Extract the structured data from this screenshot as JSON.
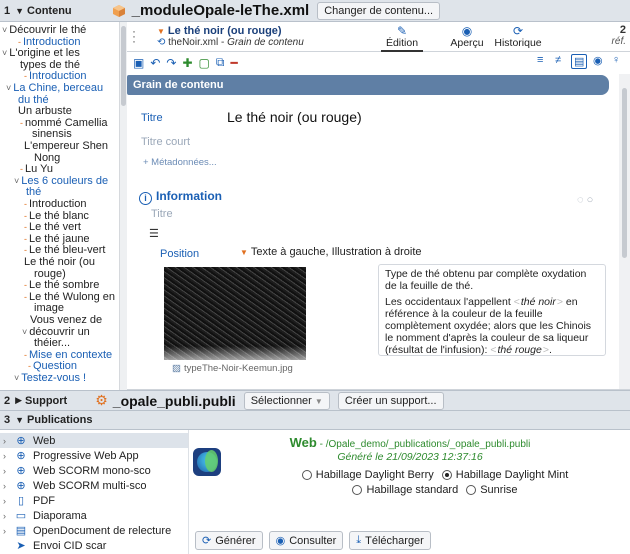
{
  "section1": {
    "number": "1",
    "label": "Contenu",
    "item_icon": "orange-cube-icon",
    "file": "_moduleOpale-leThe.xml",
    "change_button": "Changer de contenu..."
  },
  "tree": [
    {
      "text": "Découvrir le thé",
      "color": "dark",
      "marker": "v"
    },
    {
      "text": "Introduction",
      "color": "blue",
      "marker": "-"
    },
    {
      "text": "L'origine et les",
      "color": "dark",
      "marker": "v"
    },
    {
      "text": "types de thé",
      "color": "dark",
      "marker": ""
    },
    {
      "text": "Introduction",
      "color": "blue",
      "marker": "-"
    },
    {
      "text": "La Chine, berceau",
      "color": "blue",
      "marker": "v"
    },
    {
      "text": "du thé",
      "color": "blue",
      "marker": ""
    },
    {
      "text": "Un arbuste",
      "color": "dark",
      "marker": ""
    },
    {
      "text": "nommé Camellia",
      "color": "dark",
      "marker": "-"
    },
    {
      "text": "sinensis",
      "color": "dark",
      "marker": ""
    },
    {
      "text": "L'empereur Shen",
      "color": "dark",
      "marker": ""
    },
    {
      "text": "Nong",
      "color": "dark",
      "marker": ""
    },
    {
      "text": "Lu Yu",
      "color": "dark",
      "marker": "-"
    },
    {
      "text": "Les 6 couleurs de",
      "color": "blue",
      "marker": "v"
    },
    {
      "text": "thé",
      "color": "blue",
      "marker": ""
    },
    {
      "text": "Introduction",
      "color": "dark",
      "marker": "-"
    },
    {
      "text": "Le thé blanc",
      "color": "dark",
      "marker": "-"
    },
    {
      "text": "Le thé vert",
      "color": "dark",
      "marker": "-"
    },
    {
      "text": "Le thé jaune",
      "color": "dark",
      "marker": "-"
    },
    {
      "text": "Le thé bleu-vert",
      "color": "dark",
      "marker": "-"
    },
    {
      "text": "Le thé noir (ou",
      "color": "dark",
      "marker": ""
    },
    {
      "text": "rouge)",
      "color": "dark",
      "marker": ""
    },
    {
      "text": "Le thé sombre",
      "color": "dark",
      "marker": "-"
    },
    {
      "text": "Le thé Wulong en",
      "color": "dark",
      "marker": "-"
    },
    {
      "text": "image",
      "color": "dark",
      "marker": ""
    },
    {
      "text": "Vous venez de",
      "color": "dark",
      "marker": ""
    },
    {
      "text": "découvrir un",
      "color": "dark",
      "marker": "v"
    },
    {
      "text": "théier...",
      "color": "dark",
      "marker": ""
    },
    {
      "text": "Mise en contexte",
      "color": "blue",
      "marker": "-"
    },
    {
      "text": "Question",
      "color": "blue",
      "marker": "-"
    },
    {
      "text": "Testez-vous !",
      "color": "blue",
      "marker": "v"
    }
  ],
  "editor": {
    "title": "Le thé noir (ou rouge)",
    "file": "theNoir.xml",
    "type": "Grain de contenu",
    "separator": " - ",
    "tabs": [
      {
        "label": "Édition",
        "icon": "pen-icon"
      },
      {
        "label": "Aperçu",
        "icon": "eye-icon"
      },
      {
        "label": "Historique",
        "icon": "history-icon"
      }
    ],
    "ref_count": "2",
    "ref_label": "réf."
  },
  "grain": {
    "header": "Grain de contenu",
    "title_label": "Titre",
    "title_value": "Le thé noir (ou rouge)",
    "short_title_label": "Titre court",
    "metadata": "+ Métadonnées...",
    "info_label": "Information",
    "info_title_label": "Titre",
    "position_label": "Position",
    "position_value": "Texte à gauche, Illustration à droite",
    "image_name": "typeThe-Noir-Keemun.jpg",
    "text_p1": "Type de thé obtenu par complète oxydation de la feuille de thé.",
    "text_p2a": "Les occidentaux l'appellent",
    "kw1": "thé noir",
    "text_p2b": "en référence à la couleur de la feuille complètement oxydée",
    "text_p2c": "; alors que les Chinois le nomment d'après la couleur de sa liqueur (résultat de l'infusion)",
    "text_p2d": ":",
    "kw2": "thé rouge",
    "text_p2e": "."
  },
  "section2": {
    "number": "2",
    "label": "Support",
    "icon": "gear-icon",
    "file": "_opale_publi.publi",
    "select_button": "Sélectionner",
    "create_button": "Créer un support..."
  },
  "section3": {
    "number": "3",
    "label": "Publications"
  },
  "publications": [
    {
      "label": "Web",
      "icon": "globe-icon",
      "selected": true
    },
    {
      "label": "Progressive Web App",
      "icon": "globe-icon",
      "selected": false
    },
    {
      "label": "Web SCORM mono-sco",
      "icon": "globe-icon",
      "selected": false
    },
    {
      "label": "Web SCORM multi-sco",
      "icon": "globe-icon",
      "selected": false
    },
    {
      "label": "PDF",
      "icon": "pdf-icon",
      "selected": false
    },
    {
      "label": "Diaporama",
      "icon": "slideshow-icon",
      "selected": false
    },
    {
      "label": "OpenDocument de relecture",
      "icon": "document-icon",
      "selected": false
    },
    {
      "label": "Envoi CID scar",
      "icon": "send-icon",
      "selected": false
    }
  ],
  "panel": {
    "name": "Web",
    "path": " - /Opale_demo/_publications/_opale_publi.publi",
    "date": "Généré le 21/09/2023 12:37:16",
    "skins": [
      {
        "label": "Habillage Daylight Berry",
        "checked": false
      },
      {
        "label": "Habillage Daylight Mint",
        "checked": true
      },
      {
        "label": "Habillage standard",
        "checked": false
      },
      {
        "label": "Sunrise",
        "checked": false
      }
    ],
    "actions": [
      {
        "label": "Générer",
        "icon": "generate-icon"
      },
      {
        "label": "Consulter",
        "icon": "eye-icon"
      },
      {
        "label": "Télécharger",
        "icon": "download-icon"
      }
    ]
  }
}
